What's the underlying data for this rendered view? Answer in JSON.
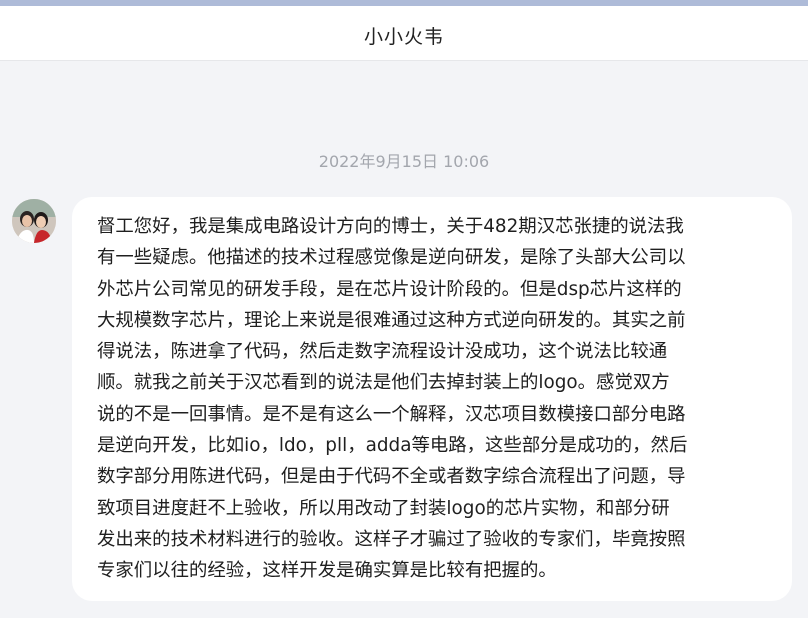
{
  "header": {
    "title": "小小火韦"
  },
  "conversation": {
    "timestamp": "2022年9月15日 10:06",
    "message": {
      "lines": [
        "督工您好，我是集成电路设计方向的博士，关于482期汉芯张捷的说法我",
        "有一些疑虑。他描述的技术过程感觉像是逆向研发，是除了头部大公司以",
        "外芯片公司常见的研发手段，是在芯片设计阶段的。但是dsp芯片这样的",
        "大规模数字芯片，理论上来说是很难通过这种方式逆向研发的。其实之前",
        "得说法，陈进拿了代码，然后走数字流程设计没成功，这个说法比较通",
        "顺。就我之前关于汉芯看到的说法是他们去掉封装上的logo。感觉双方",
        "说的不是一回事情。是不是有这么一个解释，汉芯项目数模接口部分电路",
        "是逆向开发，比如io，ldo，pll，adda等电路，这些部分是成功的，然后",
        "数字部分用陈进代码，但是由于代码不全或者数字综合流程出了问题，导",
        "致项目进度赶不上验收，所以用改动了封装logo的芯片实物，和部分研",
        "发出来的技术材料进行的验收。这样子才骗过了验收的专家们，毕竟按照",
        "专家们以往的经验，这样开发是确实算是比较有把握的。"
      ]
    }
  },
  "colors": {
    "background": "#f3f4f7",
    "bubble": "#ffffff",
    "header": "#ffffff",
    "top_strip": "#aebbd8",
    "timestamp_text": "#a3a6ad"
  },
  "icons": {
    "avatar": "user-avatar-photo"
  }
}
